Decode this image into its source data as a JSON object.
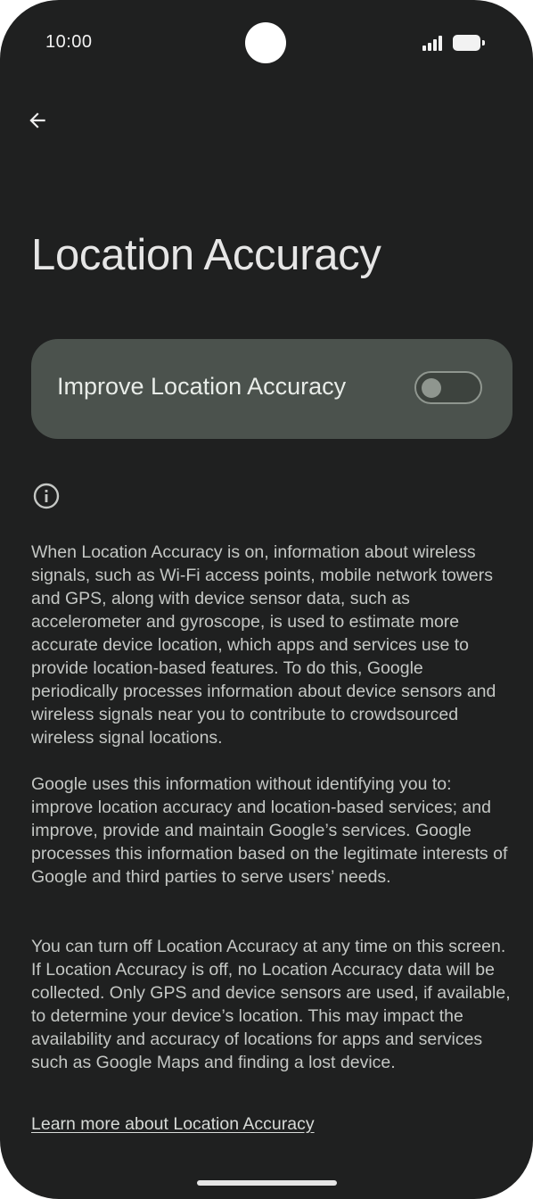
{
  "status_bar": {
    "time": "10:00"
  },
  "header": {
    "back_icon": "arrow-back-icon",
    "title": "Location Accuracy"
  },
  "toggle": {
    "label": "Improve Location Accuracy",
    "state": "off"
  },
  "info": {
    "icon": "info-icon",
    "paragraphs": [
      "When Location Accuracy is on, information about wireless signals, such as Wi-Fi access points, mobile network towers and GPS, along with device sensor data, such as accelerometer and gyroscope, is used to estimate more accurate device location, which apps and services use to provide location-based features. To do this, Google periodically processes information about device sensors and wireless signals near you to contribute to crowdsourced wireless signal locations.",
      "Google uses this information without identifying you to: improve location accuracy and location-based services; and improve, provide and maintain Google’s services. Google processes this information based on the legitimate interests of Google and third parties to serve users’ needs.",
      "You can turn off Location Accuracy at any time on this screen. If Location Accuracy is off, no Location Accuracy data will be collected. Only GPS and device sensors are used, if available, to determine your device’s location. This may impact the availability and accuracy of locations for apps and services such as Google Maps and finding a lost device."
    ],
    "learn_more": "Learn more about Location Accuracy"
  },
  "colors": {
    "background": "#1f2020",
    "card": "#4b524d",
    "text": "#c4c7c4"
  }
}
